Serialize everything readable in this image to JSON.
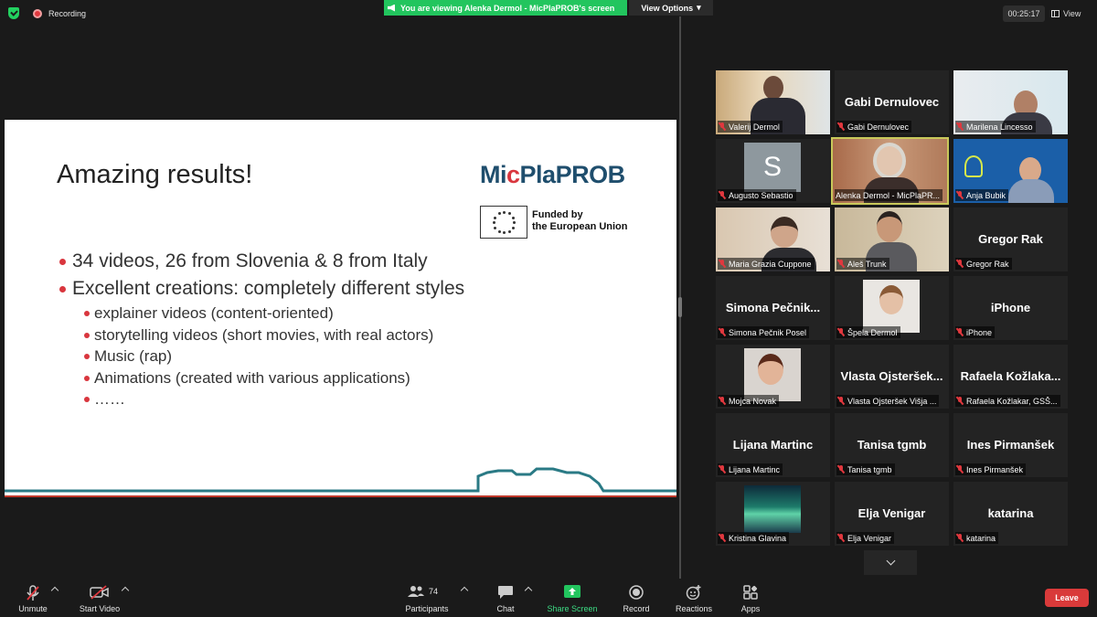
{
  "topbar": {
    "recording_label": "Recording",
    "viewing_banner": "You are viewing Alenka Dermol - MicPlaPROB's screen",
    "view_options_label": "View Options",
    "timer": "00:25:17",
    "view_label": "View"
  },
  "slide": {
    "title": "Amazing results!",
    "logo": {
      "part1": "Mi",
      "part2": "c",
      "part3": "Pla",
      "part4": "PROB"
    },
    "eu_text_line1": "Funded by",
    "eu_text_line2": "the European Union",
    "bullets": [
      "34 videos, 26 from Slovenia & 8 from Italy",
      "Excellent creations: completely different styles"
    ],
    "sub_bullets": [
      "explainer videos (content-oriented)",
      "storytelling videos (short movies, with real actors)",
      "Music (rap)",
      "Animations (created with various applications)",
      "……"
    ]
  },
  "participants": [
    {
      "caption": "Valerij Dermol",
      "big_name": "",
      "video": "photo"
    },
    {
      "caption": "Gabi Dernulovec",
      "big_name": "Gabi Dernulovec",
      "video": "name"
    },
    {
      "caption": "Marilena Lincesso",
      "big_name": "",
      "video": "photo"
    },
    {
      "caption": "Augusto Sebastio",
      "big_name": "",
      "video": "avatar",
      "initial": "S"
    },
    {
      "caption": "Alenka Dermol - MicPlaPR...",
      "big_name": "",
      "video": "photo",
      "active": true
    },
    {
      "caption": "Anja Bubik",
      "big_name": "",
      "video": "photo"
    },
    {
      "caption": "Maria Grazia Cuppone",
      "big_name": "",
      "video": "photo"
    },
    {
      "caption": "Aleš Trunk",
      "big_name": "",
      "video": "photo"
    },
    {
      "caption": "Gregor Rak",
      "big_name": "Gregor Rak",
      "video": "name"
    },
    {
      "caption": "Simona Pečnik Posel",
      "big_name": "Simona  Pečnik...",
      "video": "name"
    },
    {
      "caption": "Špela Dermol",
      "big_name": "",
      "video": "photo"
    },
    {
      "caption": "iPhone",
      "big_name": "iPhone",
      "video": "name"
    },
    {
      "caption": "Mojca Novak",
      "big_name": "",
      "video": "photo"
    },
    {
      "caption": "Vlasta Ojsteršek Višja ...",
      "big_name": "Vlasta  Ojsteršek...",
      "video": "name"
    },
    {
      "caption": "Rafaela Kožlakar, GSŠ...",
      "big_name": "Rafaela  Kožlaka...",
      "video": "name"
    },
    {
      "caption": "Lijana Martinc",
      "big_name": "Lijana Martinc",
      "video": "name"
    },
    {
      "caption": "Tanisa tgmb",
      "big_name": "Tanisa tgmb",
      "video": "name"
    },
    {
      "caption": "Ines Pirmanšek",
      "big_name": "Ines Pirmanšek",
      "video": "name"
    },
    {
      "caption": "Kristina Glavina",
      "big_name": "",
      "video": "photo"
    },
    {
      "caption": "Elja Venigar",
      "big_name": "Elja Venigar",
      "video": "name"
    },
    {
      "caption": "katarina",
      "big_name": "katarina",
      "video": "name"
    }
  ],
  "toolbar": {
    "unmute": "Unmute",
    "start_video": "Start Video",
    "participants": "Participants",
    "participants_count": "74",
    "chat": "Chat",
    "share_screen": "Share Screen",
    "record": "Record",
    "reactions": "Reactions",
    "apps": "Apps",
    "leave": "Leave"
  },
  "colors": {
    "accent_green": "#22c55e",
    "leave_red": "#d93a3a",
    "slide_blue": "#1f4e6d",
    "slide_red": "#d9363e"
  }
}
